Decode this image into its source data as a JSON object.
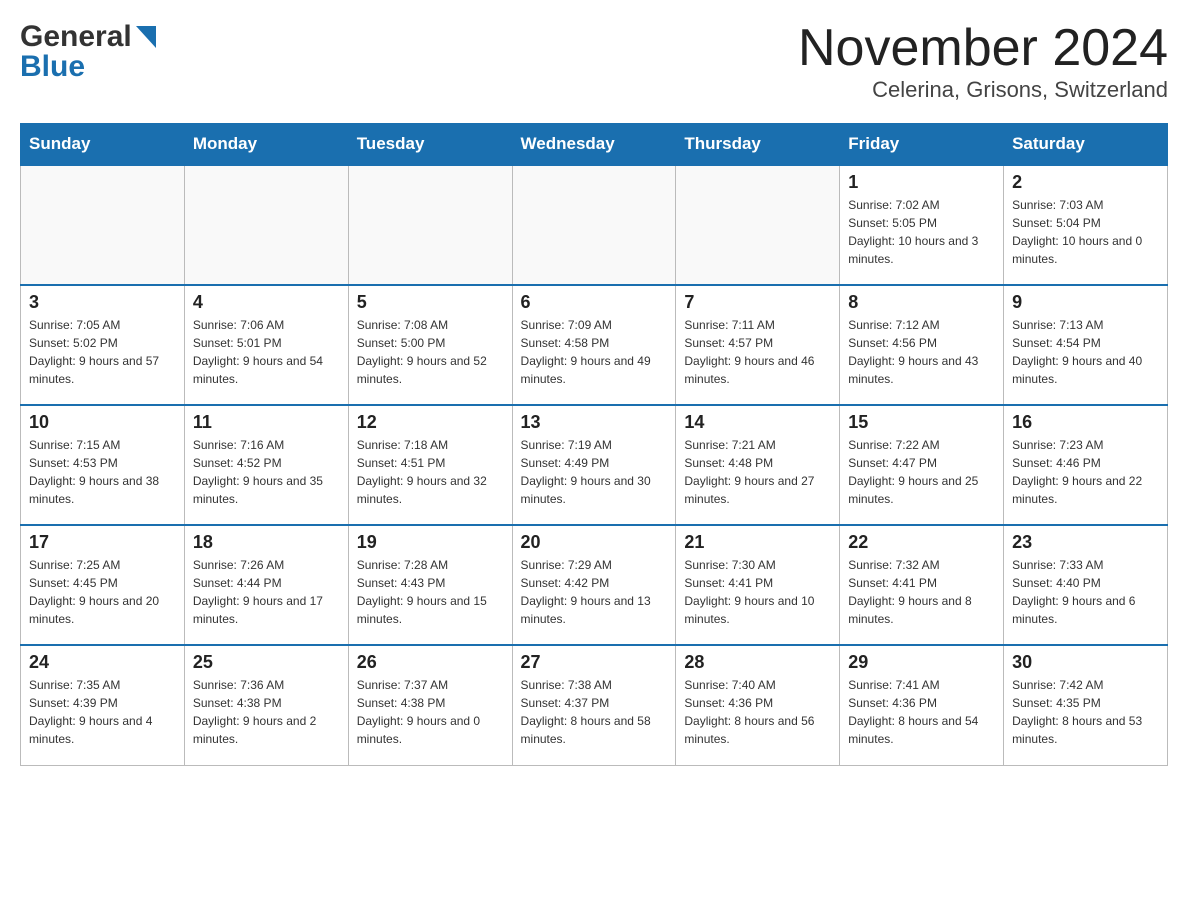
{
  "header": {
    "logo_general": "General",
    "logo_blue": "Blue",
    "month_title": "November 2024",
    "location": "Celerina, Grisons, Switzerland"
  },
  "calendar": {
    "days_of_week": [
      "Sunday",
      "Monday",
      "Tuesday",
      "Wednesday",
      "Thursday",
      "Friday",
      "Saturday"
    ],
    "weeks": [
      [
        {
          "day": "",
          "info": ""
        },
        {
          "day": "",
          "info": ""
        },
        {
          "day": "",
          "info": ""
        },
        {
          "day": "",
          "info": ""
        },
        {
          "day": "",
          "info": ""
        },
        {
          "day": "1",
          "info": "Sunrise: 7:02 AM\nSunset: 5:05 PM\nDaylight: 10 hours and 3 minutes."
        },
        {
          "day": "2",
          "info": "Sunrise: 7:03 AM\nSunset: 5:04 PM\nDaylight: 10 hours and 0 minutes."
        }
      ],
      [
        {
          "day": "3",
          "info": "Sunrise: 7:05 AM\nSunset: 5:02 PM\nDaylight: 9 hours and 57 minutes."
        },
        {
          "day": "4",
          "info": "Sunrise: 7:06 AM\nSunset: 5:01 PM\nDaylight: 9 hours and 54 minutes."
        },
        {
          "day": "5",
          "info": "Sunrise: 7:08 AM\nSunset: 5:00 PM\nDaylight: 9 hours and 52 minutes."
        },
        {
          "day": "6",
          "info": "Sunrise: 7:09 AM\nSunset: 4:58 PM\nDaylight: 9 hours and 49 minutes."
        },
        {
          "day": "7",
          "info": "Sunrise: 7:11 AM\nSunset: 4:57 PM\nDaylight: 9 hours and 46 minutes."
        },
        {
          "day": "8",
          "info": "Sunrise: 7:12 AM\nSunset: 4:56 PM\nDaylight: 9 hours and 43 minutes."
        },
        {
          "day": "9",
          "info": "Sunrise: 7:13 AM\nSunset: 4:54 PM\nDaylight: 9 hours and 40 minutes."
        }
      ],
      [
        {
          "day": "10",
          "info": "Sunrise: 7:15 AM\nSunset: 4:53 PM\nDaylight: 9 hours and 38 minutes."
        },
        {
          "day": "11",
          "info": "Sunrise: 7:16 AM\nSunset: 4:52 PM\nDaylight: 9 hours and 35 minutes."
        },
        {
          "day": "12",
          "info": "Sunrise: 7:18 AM\nSunset: 4:51 PM\nDaylight: 9 hours and 32 minutes."
        },
        {
          "day": "13",
          "info": "Sunrise: 7:19 AM\nSunset: 4:49 PM\nDaylight: 9 hours and 30 minutes."
        },
        {
          "day": "14",
          "info": "Sunrise: 7:21 AM\nSunset: 4:48 PM\nDaylight: 9 hours and 27 minutes."
        },
        {
          "day": "15",
          "info": "Sunrise: 7:22 AM\nSunset: 4:47 PM\nDaylight: 9 hours and 25 minutes."
        },
        {
          "day": "16",
          "info": "Sunrise: 7:23 AM\nSunset: 4:46 PM\nDaylight: 9 hours and 22 minutes."
        }
      ],
      [
        {
          "day": "17",
          "info": "Sunrise: 7:25 AM\nSunset: 4:45 PM\nDaylight: 9 hours and 20 minutes."
        },
        {
          "day": "18",
          "info": "Sunrise: 7:26 AM\nSunset: 4:44 PM\nDaylight: 9 hours and 17 minutes."
        },
        {
          "day": "19",
          "info": "Sunrise: 7:28 AM\nSunset: 4:43 PM\nDaylight: 9 hours and 15 minutes."
        },
        {
          "day": "20",
          "info": "Sunrise: 7:29 AM\nSunset: 4:42 PM\nDaylight: 9 hours and 13 minutes."
        },
        {
          "day": "21",
          "info": "Sunrise: 7:30 AM\nSunset: 4:41 PM\nDaylight: 9 hours and 10 minutes."
        },
        {
          "day": "22",
          "info": "Sunrise: 7:32 AM\nSunset: 4:41 PM\nDaylight: 9 hours and 8 minutes."
        },
        {
          "day": "23",
          "info": "Sunrise: 7:33 AM\nSunset: 4:40 PM\nDaylight: 9 hours and 6 minutes."
        }
      ],
      [
        {
          "day": "24",
          "info": "Sunrise: 7:35 AM\nSunset: 4:39 PM\nDaylight: 9 hours and 4 minutes."
        },
        {
          "day": "25",
          "info": "Sunrise: 7:36 AM\nSunset: 4:38 PM\nDaylight: 9 hours and 2 minutes."
        },
        {
          "day": "26",
          "info": "Sunrise: 7:37 AM\nSunset: 4:38 PM\nDaylight: 9 hours and 0 minutes."
        },
        {
          "day": "27",
          "info": "Sunrise: 7:38 AM\nSunset: 4:37 PM\nDaylight: 8 hours and 58 minutes."
        },
        {
          "day": "28",
          "info": "Sunrise: 7:40 AM\nSunset: 4:36 PM\nDaylight: 8 hours and 56 minutes."
        },
        {
          "day": "29",
          "info": "Sunrise: 7:41 AM\nSunset: 4:36 PM\nDaylight: 8 hours and 54 minutes."
        },
        {
          "day": "30",
          "info": "Sunrise: 7:42 AM\nSunset: 4:35 PM\nDaylight: 8 hours and 53 minutes."
        }
      ]
    ]
  }
}
